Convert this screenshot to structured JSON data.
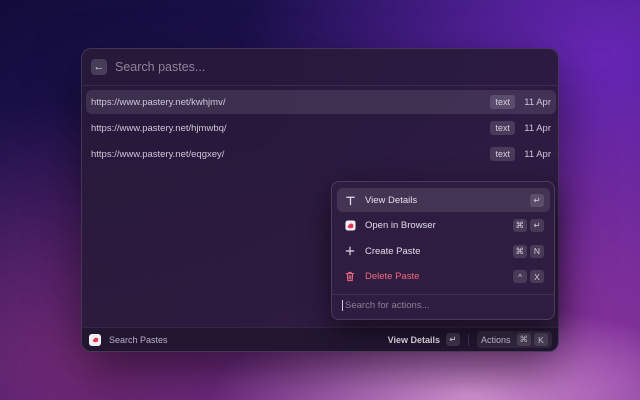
{
  "search": {
    "placeholder": "Search pastes..."
  },
  "pastes": [
    {
      "url": "https://www.pastery.net/kwhjmv/",
      "type": "text",
      "date": "11 Apr"
    },
    {
      "url": "https://www.pastery.net/hjmwbq/",
      "type": "text",
      "date": "11 Apr"
    },
    {
      "url": "https://www.pastery.net/eqgxey/",
      "type": "text",
      "date": "11 Apr"
    }
  ],
  "actions": [
    {
      "label": "View Details",
      "icon": "text-icon",
      "keys": [
        "↵"
      ]
    },
    {
      "label": "Open in Browser",
      "icon": "pastery-app-icon",
      "keys": [
        "⌘",
        "↵"
      ]
    },
    {
      "label": "Create Paste",
      "icon": "plus-icon",
      "keys": [
        "⌘",
        "N"
      ]
    },
    {
      "label": "Delete Paste",
      "icon": "trash-icon",
      "keys": [
        "^",
        "X"
      ]
    }
  ],
  "action_search": {
    "placeholder": "Search for actions..."
  },
  "footer": {
    "title": "Search Pastes",
    "primary_label": "View Details",
    "primary_key": "↵",
    "actions_label": "Actions",
    "actions_keys": [
      "⌘",
      "K"
    ]
  },
  "colors": {
    "danger": "#f06a7f",
    "accent_bg": "#2e1e40"
  }
}
